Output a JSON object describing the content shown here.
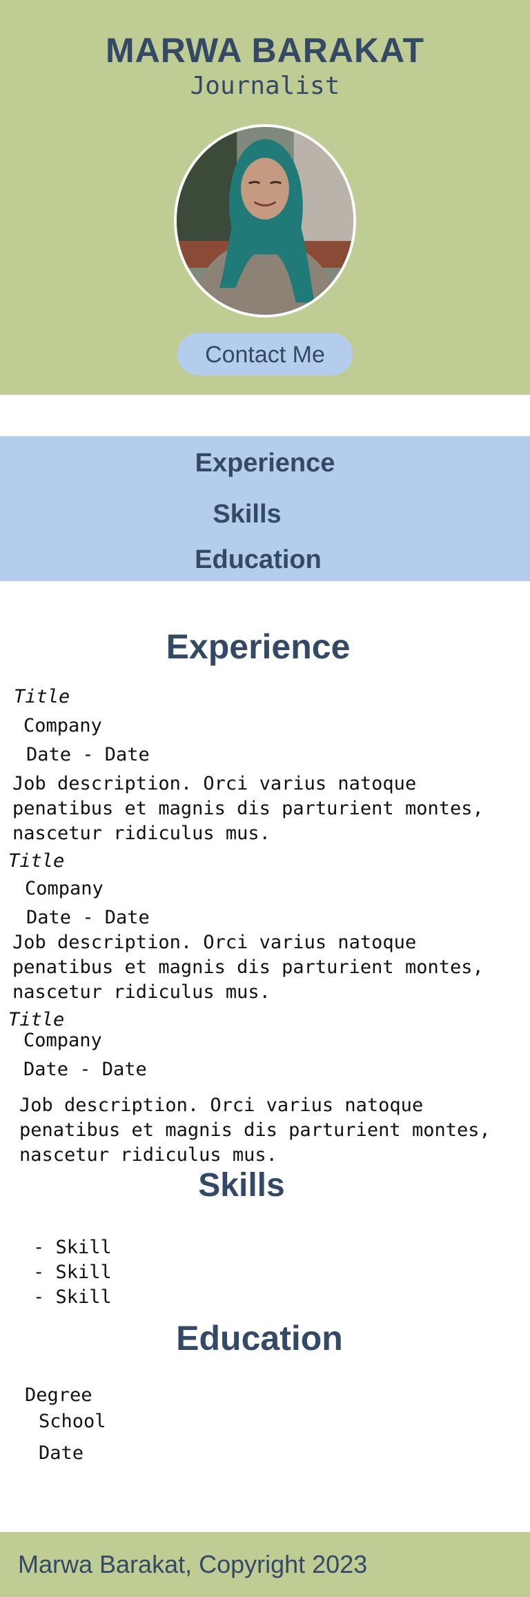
{
  "header": {
    "name": "MARWA BARAKAT",
    "role": "Journalist",
    "contact_label": "Contact Me"
  },
  "nav": {
    "items": [
      "Experience",
      "Skills",
      "Education"
    ]
  },
  "experience": {
    "heading": "Experience",
    "jobs": [
      {
        "title": "Title",
        "company": "Company",
        "dates": "Date - Date",
        "description": "Job description. Orci varius natoque penatibus et magnis dis parturient montes, nascetur ridiculus mus."
      },
      {
        "title": "Title",
        "company": "Company",
        "dates": "Date - Date",
        "description": "Job description. Orci varius natoque penatibus et magnis dis parturient montes, nascetur ridiculus mus."
      },
      {
        "title": "Title",
        "company": "Company",
        "dates": "Date - Date",
        "description": "Job description. Orci varius natoque penatibus et magnis dis parturient montes, nascetur ridiculus mus."
      }
    ]
  },
  "skills": {
    "heading": "Skills",
    "items": [
      "- Skill",
      "- Skill",
      "- Skill"
    ]
  },
  "education": {
    "heading": "Education",
    "degree": "Degree",
    "school": "School",
    "date": "Date"
  },
  "footer": {
    "text": "Marwa Barakat, Copyright 2023"
  },
  "colors": {
    "header_bg": "#bfcc94",
    "nav_bg": "#b4cdec",
    "heading_text": "#344966"
  }
}
